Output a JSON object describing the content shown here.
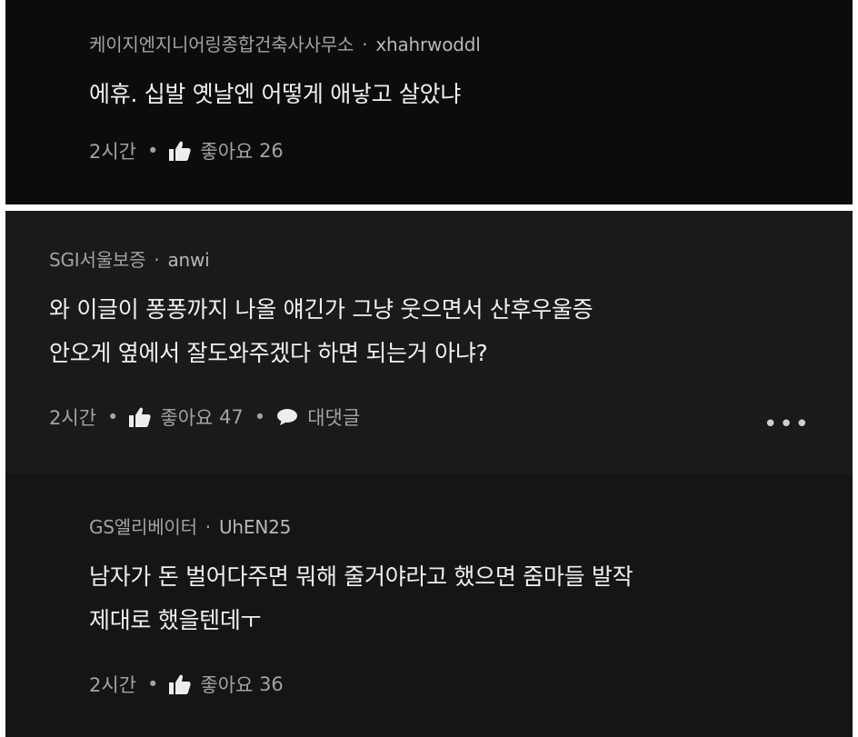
{
  "comments": [
    {
      "company": "케이지엔지니어링종합건축사사무소",
      "separator": "·",
      "username": "xhahrwoddl",
      "lines": [
        "에휴. 십발 옛날엔 어떻게 애낳고 살았냐"
      ],
      "time": "2시간",
      "like_label": "좋아요",
      "like_count": "26"
    },
    {
      "company": "SGI서울보증",
      "separator": "·",
      "username": "anwi",
      "lines": [
        "와 이글이 퐁퐁까지 나올 얘긴가 그냥 웃으면서 산후우울증",
        "안오게 옆에서 잘도와주겠다 하면 되는거 아냐?"
      ],
      "time": "2시간",
      "like_label": "좋아요",
      "like_count": "47",
      "reply_label": "대댓글",
      "more_label": "•••"
    },
    {
      "company": "GS엘리베이터",
      "separator": "·",
      "username": "UhEN25",
      "lines": [
        "남자가 돈 벌어다주면 뭐해 줄거야라고 했으면 줌마들 발작",
        "제대로 했을텐데ㅜ"
      ],
      "time": "2시간",
      "like_label": "좋아요",
      "like_count": "36"
    }
  ],
  "action_separator": "•",
  "icons": {
    "like": "thumbs-up-icon",
    "reply": "speech-bubble-icon",
    "more": "more-dots-icon"
  },
  "colors": {
    "background": "#0c0c0c",
    "card": "#1a1a1a",
    "text": "#f0f0f0",
    "meta": "#a3a3a3"
  }
}
